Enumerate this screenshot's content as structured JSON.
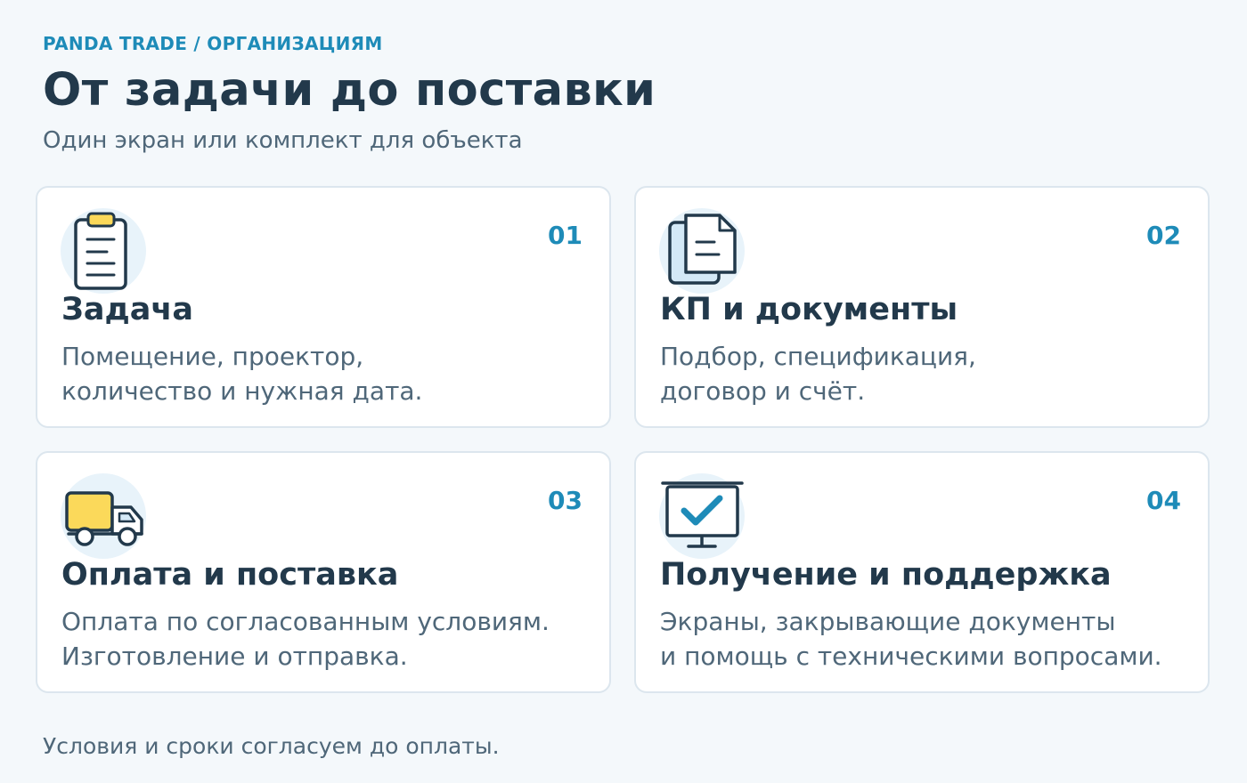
{
  "header": {
    "eyebrow": "PANDA TRADE / ОРГАНИЗАЦИЯМ",
    "title": "От задачи до поставки",
    "subtitle": "Один экран или комплект для объекта"
  },
  "steps": [
    {
      "number": "01",
      "icon": "clipboard-icon",
      "title": "Задача",
      "lines": [
        "Помещение, проектор,",
        "количество и нужная дата."
      ]
    },
    {
      "number": "02",
      "icon": "documents-icon",
      "title": "КП и документы",
      "lines": [
        "Подбор, спецификация,",
        "договор и счёт."
      ]
    },
    {
      "number": "03",
      "icon": "delivery-truck-icon",
      "title": "Оплата и поставка",
      "lines": [
        "Оплата по согласованным условиям.",
        "Изготовление и отправка."
      ]
    },
    {
      "number": "04",
      "icon": "projection-screen-check-icon",
      "title": "Получение и поддержка",
      "lines": [
        "Экраны, закрывающие документы",
        "и помощь с техническими вопросами."
      ]
    }
  ],
  "footer": {
    "note": "Условия и сроки согласуем до оплаты."
  },
  "colors": {
    "background": "#f4f8fb",
    "accent": "#1e8bb8",
    "heading": "#22394b",
    "text": "#4f6779",
    "icon_yellow": "#fbd95a",
    "icon_blue_fill": "#d4e9f7"
  }
}
